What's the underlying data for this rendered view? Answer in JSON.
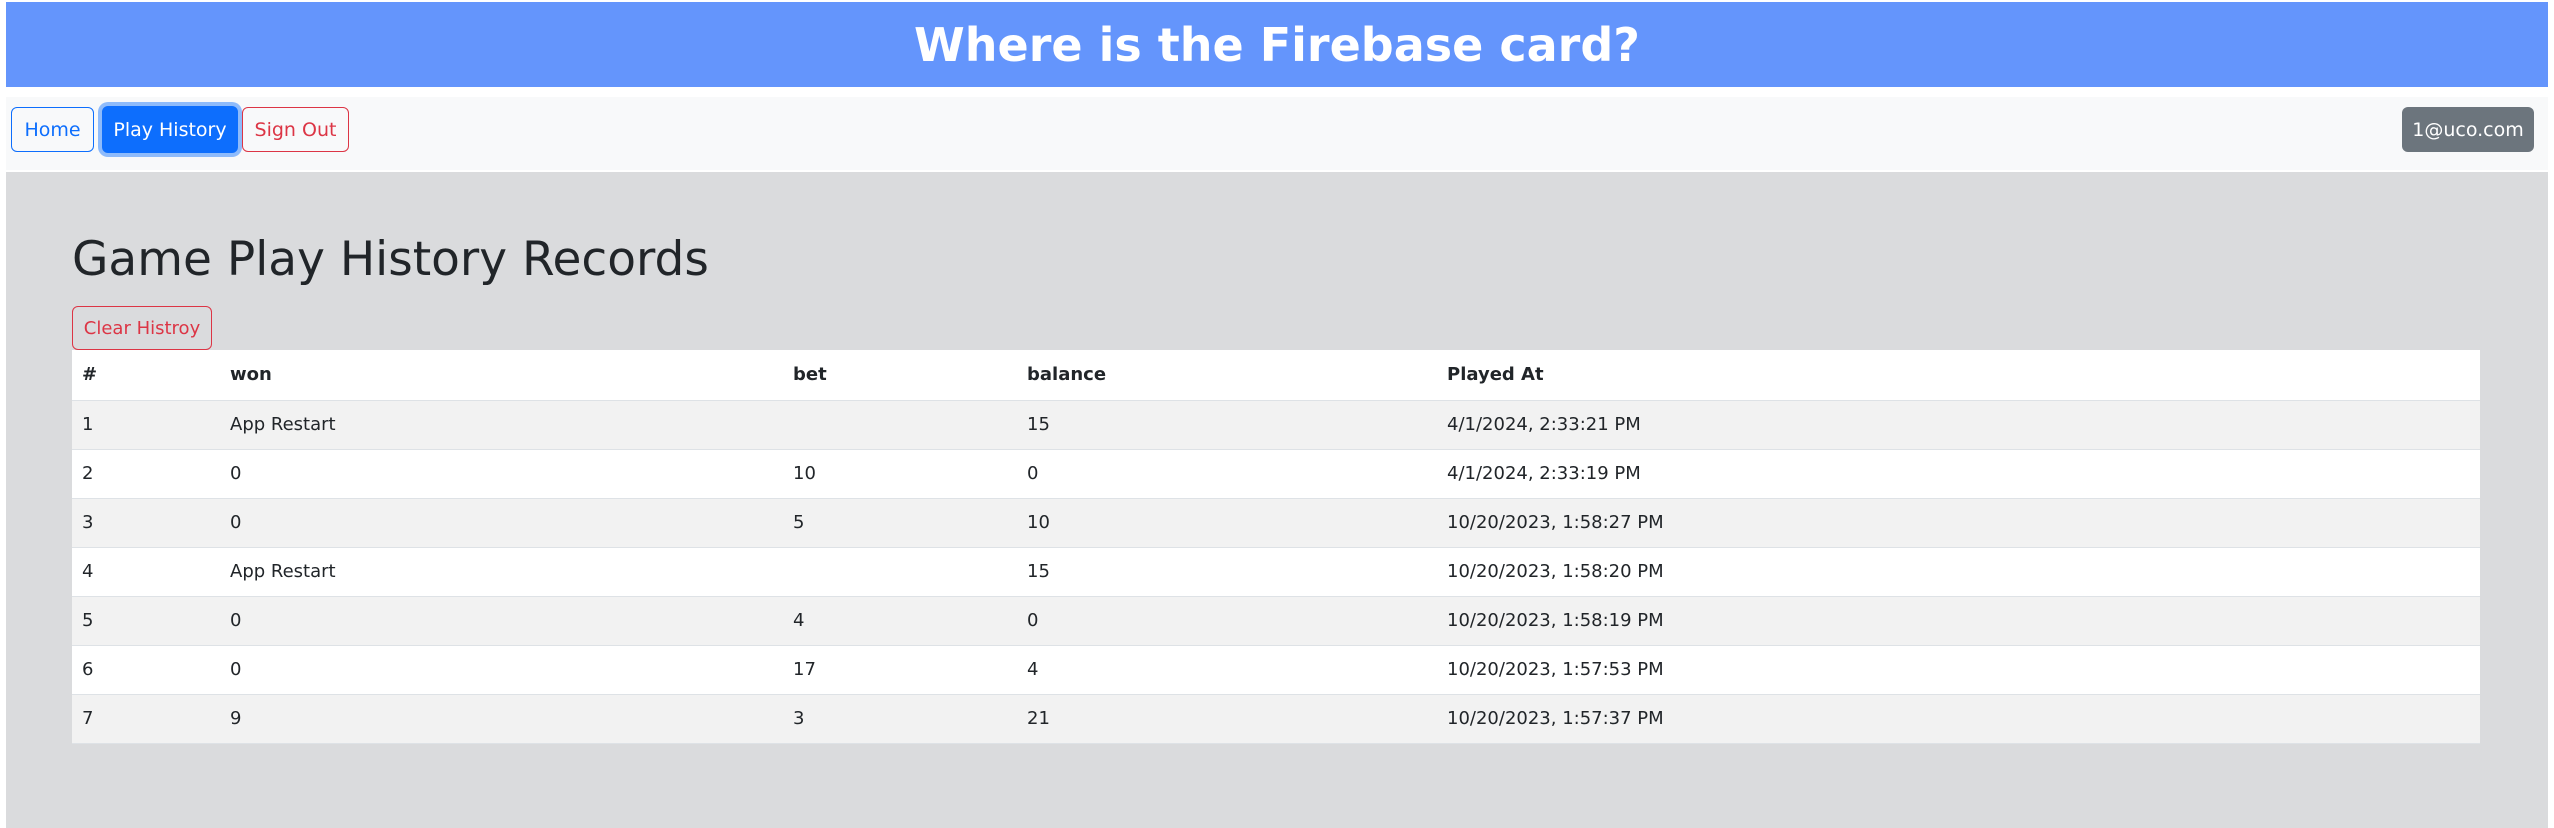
{
  "header": {
    "title": "Where is the Firebase card?"
  },
  "nav": {
    "home_label": "Home",
    "history_label": "Play History",
    "signout_label": "Sign Out",
    "user_email": "1@uco.com"
  },
  "main": {
    "title": "Game Play History Records",
    "clear_label": "Clear Histroy"
  },
  "table": {
    "headers": [
      "#",
      "won",
      "bet",
      "balance",
      "Played At"
    ],
    "rows": [
      [
        "1",
        "App Restart",
        "",
        "15",
        "4/1/2024, 2:33:21 PM"
      ],
      [
        "2",
        "0",
        "10",
        "0",
        "4/1/2024, 2:33:19 PM"
      ],
      [
        "3",
        "0",
        "5",
        "10",
        "10/20/2023, 1:58:27 PM"
      ],
      [
        "4",
        "App Restart",
        "",
        "15",
        "10/20/2023, 1:58:20 PM"
      ],
      [
        "5",
        "0",
        "4",
        "0",
        "10/20/2023, 1:58:19 PM"
      ],
      [
        "6",
        "0",
        "17",
        "4",
        "10/20/2023, 1:57:53 PM"
      ],
      [
        "7",
        "9",
        "3",
        "21",
        "10/20/2023, 1:57:37 PM"
      ]
    ]
  },
  "colors": {
    "header_bg": "#6495fc",
    "primary": "#0d6efd",
    "danger": "#dc3545",
    "secondary": "#6c757d",
    "main_bg": "#dadbdd"
  }
}
